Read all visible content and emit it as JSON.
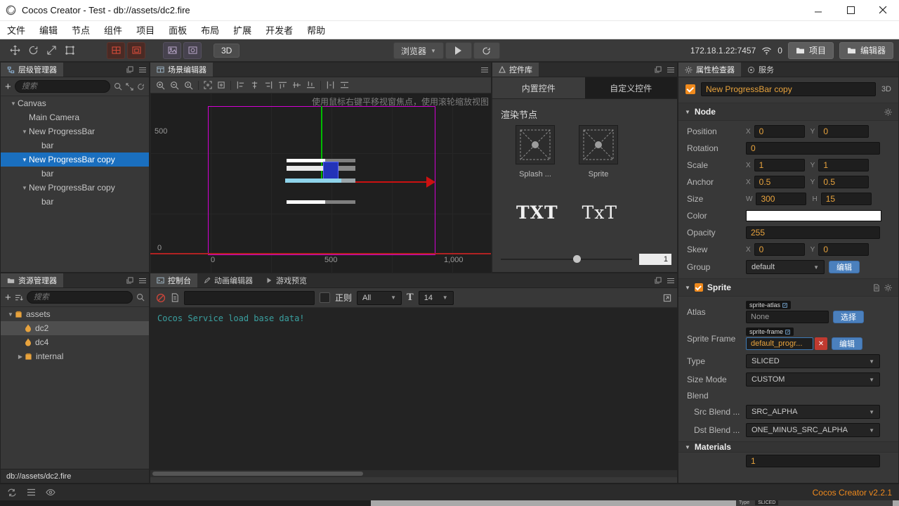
{
  "window": {
    "title": "Cocos Creator - Test - db://assets/dc2.fire"
  },
  "menubar": {
    "items": [
      "文件",
      "编辑",
      "节点",
      "组件",
      "项目",
      "面板",
      "布局",
      "扩展",
      "开发者",
      "帮助"
    ]
  },
  "toolbar": {
    "mode_3d": "3D",
    "preview_target": "浏览器",
    "address": "172.18.1.22:7457",
    "connections": "0",
    "project": "项目",
    "editor": "编辑器"
  },
  "labels": {
    "x": "X",
    "y": "Y",
    "w": "W",
    "h": "H",
    "t": "T"
  },
  "hierarchy": {
    "title": "层级管理器",
    "search_placeholder": "搜索",
    "nodes": [
      {
        "label": "Canvas"
      },
      {
        "label": "Main Camera"
      },
      {
        "label": "New ProgressBar"
      },
      {
        "label": "bar"
      },
      {
        "label": "New ProgressBar copy"
      },
      {
        "label": "bar"
      },
      {
        "label": "New ProgressBar copy"
      },
      {
        "label": "bar"
      }
    ]
  },
  "assets": {
    "title": "资源管理器",
    "search_placeholder": "搜索",
    "items": [
      {
        "label": "assets"
      },
      {
        "label": "dc2"
      },
      {
        "label": "dc4"
      },
      {
        "label": "internal"
      }
    ],
    "status": "db://assets/dc2.fire"
  },
  "scene": {
    "tab": "场景编辑器",
    "hint": "使用鼠标右键平移视窗焦点，使用滚轮缩放视图",
    "ruler_left_top": "500",
    "ruler_left_bottom": "0",
    "ruler_bottom": [
      "0",
      "500",
      "1,000"
    ]
  },
  "library": {
    "title": "控件库",
    "tab_builtin": "内置控件",
    "tab_custom": "自定义控件",
    "section": "渲染节点",
    "item1": "Splash ...",
    "item2": "Sprite",
    "txt1": "TXT",
    "txt2": "TxT",
    "slider_value": "1"
  },
  "console": {
    "tab_console": "控制台",
    "tab_anim": "动画编辑器",
    "tab_preview": "游戏预览",
    "regex_label": "正则",
    "filter_value": "All",
    "font_size": "14",
    "log": "Cocos Service load base data!"
  },
  "inspector": {
    "tab_props": "属性检查器",
    "tab_service": "服务",
    "node_name": "New ProgressBar copy",
    "mode": "3D",
    "node_section": "Node",
    "position": {
      "label": "Position",
      "x": "0",
      "y": "0"
    },
    "rotation": {
      "label": "Rotation",
      "value": "0"
    },
    "scale": {
      "label": "Scale",
      "x": "1",
      "y": "1"
    },
    "anchor": {
      "label": "Anchor",
      "x": "0.5",
      "y": "0.5"
    },
    "size": {
      "label": "Size",
      "w": "300",
      "h": "15"
    },
    "color": {
      "label": "Color"
    },
    "opacity": {
      "label": "Opacity",
      "value": "255"
    },
    "skew": {
      "label": "Skew",
      "x": "0",
      "y": "0"
    },
    "group": {
      "label": "Group",
      "value": "default",
      "button": "编辑"
    },
    "sprite_section": "Sprite",
    "atlas": {
      "label": "Atlas",
      "badge": "sprite-atlas",
      "value": "None",
      "button": "选择"
    },
    "sprite_frame": {
      "label": "Sprite Frame",
      "badge": "sprite-frame",
      "value": "default_progr...",
      "button": "编辑"
    },
    "type": {
      "label": "Type",
      "value": "SLICED"
    },
    "size_mode": {
      "label": "Size Mode",
      "value": "CUSTOM"
    },
    "blend_label": "Blend",
    "src_blend": {
      "label": "Src Blend ...",
      "value": "SRC_ALPHA"
    },
    "dst_blend": {
      "label": "Dst Blend ...",
      "value": "ONE_MINUS_SRC_ALPHA"
    },
    "materials_section": "Materials",
    "materials_value": "1"
  },
  "statusbar": {
    "version": "Cocos Creator v2.2.1"
  },
  "fragment": {
    "label": "Type",
    "value": "SLICED"
  },
  "colors": {
    "accent_orange": "#f08a1d",
    "value_orange": "#e8a33d",
    "selection_blue": "#1a6fbf",
    "button_blue": "#4b80bd",
    "console_teal": "#3aa0a0"
  }
}
